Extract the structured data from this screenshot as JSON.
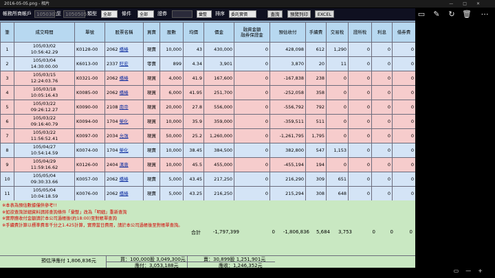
{
  "window": {
    "title": "2016-05-05.png - 相片",
    "controls": [
      "—",
      "□",
      "✕"
    ]
  },
  "viewer_tools": [
    {
      "name": "share-icon",
      "glyph": "⇪"
    },
    {
      "name": "slideshow-icon",
      "glyph": "▭"
    },
    {
      "name": "edit-icon",
      "glyph": "✎"
    },
    {
      "name": "rotate-icon",
      "glyph": "↻"
    },
    {
      "name": "delete-icon",
      "glyph": "🗑"
    },
    {
      "name": "more-icon",
      "glyph": "⋯"
    }
  ],
  "toolbar": {
    "app_label": "帳務所商帳戶",
    "date_from": "1050301",
    "to_label": "至",
    "date_to": "1050505",
    "type_label": "類型",
    "type_value": "全部",
    "cond_label": "條件",
    "cond_value": "全部",
    "stock_label": "證券",
    "stock_value": "",
    "summary_value": "彙整",
    "sort_label": "排序",
    "sort_value": "委託實價",
    "query_button": "查詢",
    "print_button": "預覽列印",
    "excel_button": "EXCEL"
  },
  "table": {
    "headers": [
      "筆",
      "成交時間",
      "單號",
      "股票名稱",
      "買賣",
      "股數",
      "均價",
      "價金",
      "融資金額\n融券保證金",
      "預估收付",
      "手續費",
      "交易稅",
      "證所稅",
      "利息",
      "借券費"
    ],
    "rows": [
      {
        "side": "buy",
        "no": "1",
        "date": "105/03/02",
        "time": "10:56:42.29",
        "order": "K0128-00",
        "code": "2062",
        "name": "橋椿",
        "trade": "現賣",
        "shares": "10,000",
        "avg": "43",
        "amount": "430,000",
        "margin": "0",
        "net": "428,098",
        "fee": "612",
        "tax": "1,290",
        "ctax": "0",
        "interest": "0",
        "lend": "0"
      },
      {
        "side": "buy",
        "no": "2",
        "date": "105/03/04",
        "time": "14:30:00.00",
        "order": "K6013-00",
        "code": "2337",
        "name": "旺宏",
        "trade": "零賣",
        "shares": "899",
        "avg": "4.34",
        "amount": "3,901",
        "margin": "0",
        "net": "3,870",
        "fee": "20",
        "tax": "11",
        "ctax": "0",
        "interest": "0",
        "lend": "0"
      },
      {
        "side": "sell",
        "no": "3",
        "date": "105/03/15",
        "time": "12:24:03.76",
        "order": "K0321-00",
        "code": "2062",
        "name": "橋椿",
        "trade": "現買",
        "shares": "4,000",
        "avg": "41.9",
        "amount": "167,600",
        "margin": "0",
        "net": "-167,838",
        "fee": "238",
        "tax": "0",
        "ctax": "0",
        "interest": "0",
        "lend": "0"
      },
      {
        "side": "sell",
        "no": "4",
        "date": "105/03/18",
        "time": "10:05:16.43",
        "order": "K0085-00",
        "code": "2062",
        "name": "橋椿",
        "trade": "現買",
        "shares": "6,000",
        "avg": "41.95",
        "amount": "251,700",
        "margin": "0",
        "net": "-252,058",
        "fee": "358",
        "tax": "0",
        "ctax": "0",
        "interest": "0",
        "lend": "0"
      },
      {
        "side": "sell",
        "no": "5",
        "date": "105/03/22",
        "time": "09:26:12.27",
        "order": "K0090-00",
        "code": "2108",
        "name": "南帝",
        "trade": "現買",
        "shares": "20,000",
        "avg": "27.8",
        "amount": "556,000",
        "margin": "0",
        "net": "-556,792",
        "fee": "792",
        "tax": "0",
        "ctax": "0",
        "interest": "0",
        "lend": "0"
      },
      {
        "side": "sell",
        "no": "6",
        "date": "105/03/22",
        "time": "09:16:40.79",
        "order": "K0094-00",
        "code": "1704",
        "name": "榮化",
        "trade": "現買",
        "shares": "10,000",
        "avg": "35.9",
        "amount": "359,000",
        "margin": "0",
        "net": "-359,511",
        "fee": "511",
        "tax": "0",
        "ctax": "0",
        "interest": "0",
        "lend": "0"
      },
      {
        "side": "sell",
        "no": "7",
        "date": "105/03/22",
        "time": "11:56:52.41",
        "order": "K0097-00",
        "code": "2034",
        "name": "允強",
        "trade": "現買",
        "shares": "50,000",
        "avg": "25.2",
        "amount": "1,260,000",
        "margin": "0",
        "net": "-1,261,795",
        "fee": "1,795",
        "tax": "0",
        "ctax": "0",
        "interest": "0",
        "lend": "0"
      },
      {
        "side": "buy",
        "no": "8",
        "date": "105/04/27",
        "time": "10:54:14.59",
        "order": "K0074-00",
        "code": "1704",
        "name": "榮化",
        "trade": "現賣",
        "shares": "10,000",
        "avg": "38.45",
        "amount": "384,500",
        "margin": "0",
        "net": "382,800",
        "fee": "547",
        "tax": "1,153",
        "ctax": "0",
        "interest": "0",
        "lend": "0"
      },
      {
        "side": "sell",
        "no": "9",
        "date": "105/04/29",
        "time": "11:59:16.62",
        "order": "K0126-00",
        "code": "2404",
        "name": "漢唐",
        "trade": "現買",
        "shares": "10,000",
        "avg": "45.5",
        "amount": "455,000",
        "margin": "0",
        "net": "-455,194",
        "fee": "194",
        "tax": "0",
        "ctax": "0",
        "interest": "0",
        "lend": "0"
      },
      {
        "side": "buy",
        "no": "10",
        "date": "105/05/04",
        "time": "09:30:33.66",
        "order": "K0057-00",
        "code": "2062",
        "name": "橋椿",
        "trade": "現賣",
        "shares": "5,000",
        "avg": "43.45",
        "amount": "217,250",
        "margin": "0",
        "net": "216,290",
        "fee": "309",
        "tax": "651",
        "ctax": "0",
        "interest": "0",
        "lend": "0"
      },
      {
        "side": "buy",
        "no": "11",
        "date": "105/05/04",
        "time": "10:04:18.59",
        "order": "K0076-00",
        "code": "2062",
        "name": "橋椿",
        "trade": "現賣",
        "shares": "5,000",
        "avg": "43.25",
        "amount": "216,250",
        "margin": "0",
        "net": "215,294",
        "fee": "308",
        "tax": "648",
        "ctax": "0",
        "interest": "0",
        "lend": "0"
      }
    ]
  },
  "footer": {
    "notes": [
      "※本表為預估數據僅供參考!!",
      "※如欲查詢詳細資料請將查詢條件「彙整」改為「明細」重新查詢",
      "※實際應收付金額請於本公司過帳後(約18:00)至對帳單查詢",
      "※手續費計算以標準費率千分之1.425計算，實際當日費用，請於本公司過帳後至對帳單查詢。"
    ],
    "total_label": "合計",
    "total_amount": "-1,797,399",
    "total_margin": "0",
    "total_net": "-1,806,836",
    "total_fee": "5,684",
    "total_tax": "3,753",
    "total_ctax": "0",
    "total_interest": "0",
    "total_lend": "0",
    "net_pay_label": "預估淨應付 1,806,836元",
    "buy_summary": "買：100,000股 3,049,300元",
    "sell_summary": "賣：30,899股 1,251,901元",
    "payable": "應付：3,053,188元",
    "receivable": "應收：1,246,352元"
  },
  "zoom": {
    "controls": [
      "▭",
      "—",
      "+"
    ]
  },
  "colors": {
    "buy_row": "#d4e4f6",
    "sell_row": "#f6cccc",
    "header": "#b7d8f0",
    "footer": "#c9e8c2",
    "note_text": "#d40000"
  }
}
